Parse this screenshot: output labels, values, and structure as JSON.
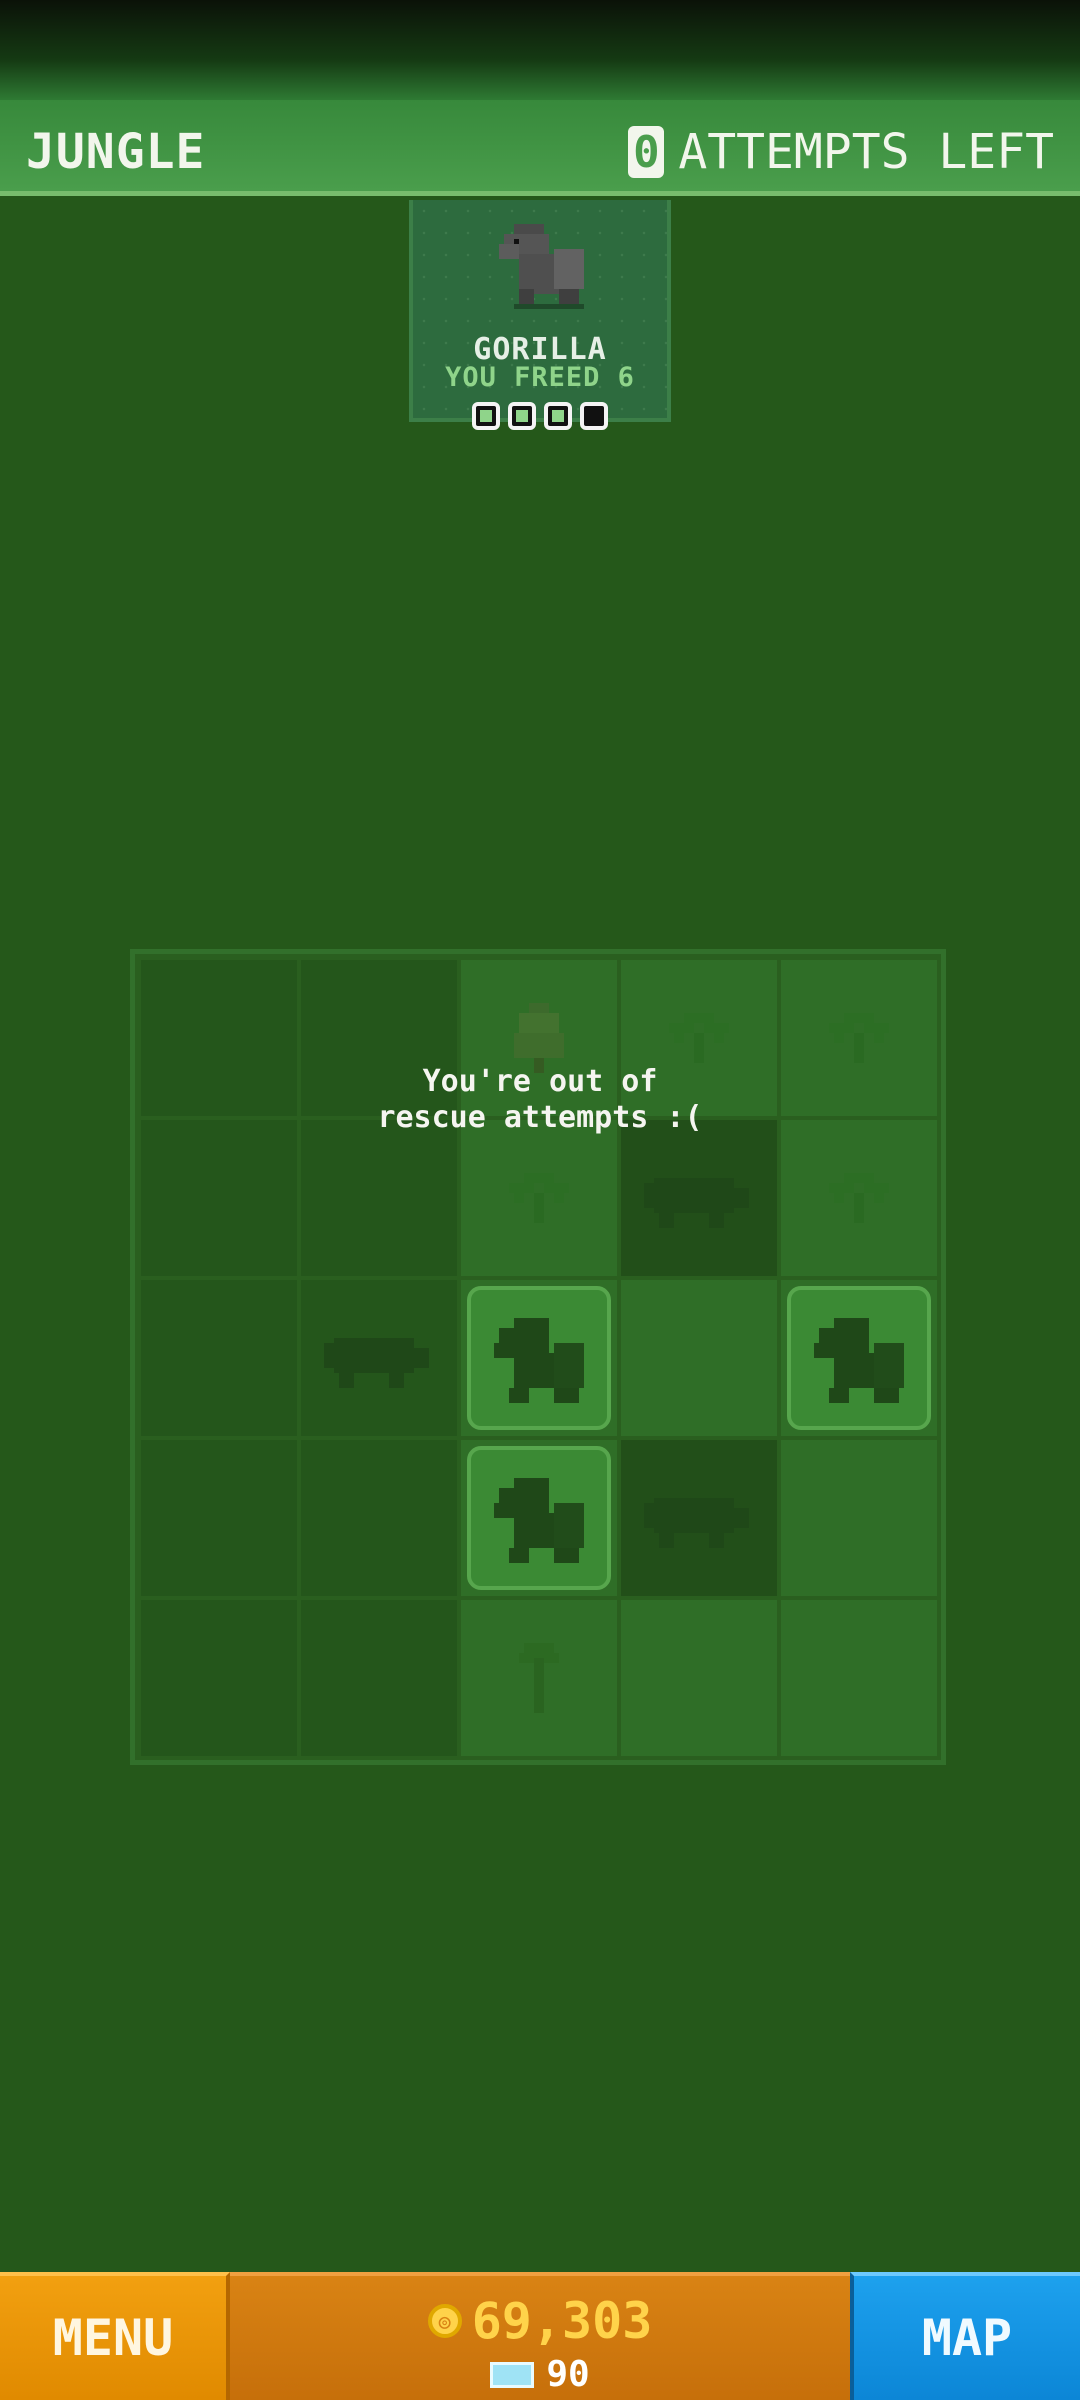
{
  "header": {
    "level_name": "JUNGLE",
    "attempts_count": "0",
    "attempts_label": "ATTEMPTS LEFT"
  },
  "animal_card": {
    "icon": "gorilla-icon",
    "name": "GORILLA",
    "freed_text": "YOU FREED 6",
    "progress": {
      "filled": 3,
      "total": 4
    }
  },
  "board": {
    "rows": [
      [
        "dark",
        "dark",
        "tree-icon",
        "palm-icon",
        "palm-icon"
      ],
      [
        "dark",
        "dark",
        "palm-icon",
        "hippo-icon",
        "palm-icon"
      ],
      [
        "dark",
        "hippo-icon",
        "gorilla-revealed",
        "light",
        "gorilla-revealed"
      ],
      [
        "dark",
        "dark",
        "gorilla-revealed",
        "hippo-icon",
        "light"
      ],
      [
        "dark",
        "dark",
        "sapling-icon",
        "light",
        "light"
      ]
    ]
  },
  "message": "You're out of\nrescue attempts :(",
  "bottom": {
    "menu_label": "MENU",
    "coins": "69,303",
    "gems": "90",
    "map_label": "MAP"
  },
  "colors": {
    "background": "#25581a",
    "header": "#4a9e4c",
    "menu": "#e08a00",
    "currency": "#d98314",
    "map": "#0c86d6",
    "coin_text": "#ffd34a"
  }
}
